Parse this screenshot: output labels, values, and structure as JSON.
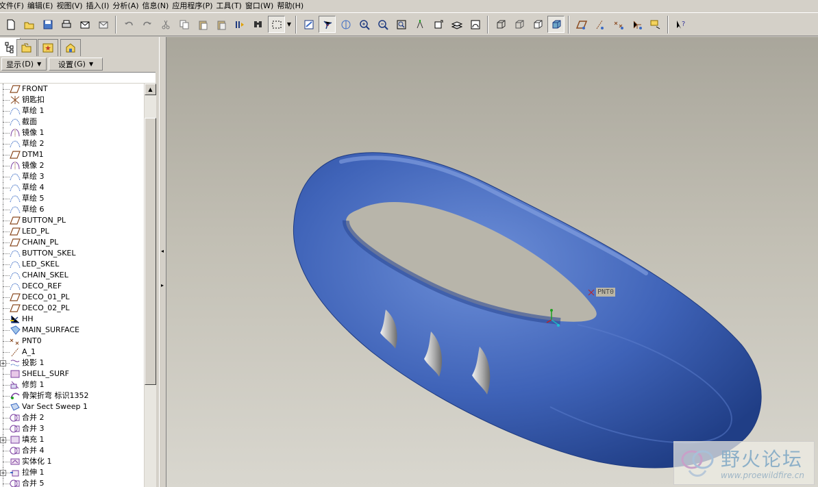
{
  "menu": [
    "文件(F)",
    "编辑(E)",
    "视图(V)",
    "插入(I)",
    "分析(A)",
    "信息(N)",
    "应用程序(P)",
    "工具(T)",
    "窗口(W)",
    "帮助(H)"
  ],
  "toolbar": {
    "groups": [
      [
        "new-file-icon",
        "open-file-icon",
        "save-icon",
        "print-icon",
        "send-mail-icon",
        "email-attach-icon"
      ],
      [
        "undo-icon",
        "redo-icon",
        "cut-icon",
        "copy-icon",
        "paste-icon",
        "paste-special-icon",
        "regenerate-icon",
        "find-icon",
        "select-box-icon"
      ],
      [
        "repaint-icon",
        "spin-center-icon",
        "orient-icon",
        "zoom-in-icon",
        "zoom-out-icon",
        "refit-icon",
        "reorient-icon",
        "saved-views-icon",
        "layers-icon",
        "appearance-icon"
      ],
      [
        "wireframe-icon",
        "hidden-line-icon",
        "no-hidden-icon",
        "shading-icon"
      ],
      [
        "datum-planes-icon",
        "datum-axes-icon",
        "datum-points-icon",
        "csys-icon",
        "annotation-icon"
      ],
      [
        "context-help-icon"
      ]
    ]
  },
  "panel": {
    "show_label": "显示",
    "show_key": "(D)",
    "settings_label": "设置",
    "settings_key": "(G)"
  },
  "tree": [
    {
      "label": "FRONT",
      "icon": "datum-plane-icon",
      "plus": false
    },
    {
      "label": "钥匙扣",
      "icon": "csys-icon",
      "plus": false
    },
    {
      "label": "草绘 1",
      "icon": "sketch-icon",
      "plus": false
    },
    {
      "label": "截面",
      "icon": "sketch-icon",
      "plus": false
    },
    {
      "label": "镜像 1",
      "icon": "mirror-icon",
      "plus": false
    },
    {
      "label": "草绘 2",
      "icon": "sketch-icon",
      "plus": false
    },
    {
      "label": "DTM1",
      "icon": "datum-plane-icon",
      "plus": false
    },
    {
      "label": "镜像 2",
      "icon": "mirror-icon",
      "plus": false
    },
    {
      "label": "草绘 3",
      "icon": "sketch-icon",
      "plus": false
    },
    {
      "label": "草绘 4",
      "icon": "sketch-icon",
      "plus": false
    },
    {
      "label": "草绘 5",
      "icon": "sketch-icon",
      "plus": false
    },
    {
      "label": "草绘 6",
      "icon": "sketch-icon",
      "plus": false
    },
    {
      "label": "BUTTON_PL",
      "icon": "datum-plane-icon",
      "plus": false
    },
    {
      "label": "LED_PL",
      "icon": "datum-plane-icon",
      "plus": false
    },
    {
      "label": "CHAIN_PL",
      "icon": "datum-plane-icon",
      "plus": false
    },
    {
      "label": "BUTTON_SKEL",
      "icon": "sketch-icon",
      "plus": false
    },
    {
      "label": "LED_SKEL",
      "icon": "sketch-icon",
      "plus": false
    },
    {
      "label": "CHAIN_SKEL",
      "icon": "sketch-icon",
      "plus": false
    },
    {
      "label": "DECO_REF",
      "icon": "sketch-icon",
      "plus": false
    },
    {
      "label": "DECO_01_PL",
      "icon": "datum-plane-icon",
      "plus": false
    },
    {
      "label": "DECO_02_PL",
      "icon": "datum-plane-icon",
      "plus": false
    },
    {
      "label": "HH",
      "icon": "coordinate-icon",
      "plus": false
    },
    {
      "label": "MAIN_SURFACE",
      "icon": "surface-icon",
      "plus": false
    },
    {
      "label": "PNT0",
      "icon": "datum-point-icon",
      "plus": false
    },
    {
      "label": "A_1",
      "icon": "datum-axis-icon",
      "plus": false
    },
    {
      "label": "投影 1",
      "icon": "projection-icon",
      "plus": true
    },
    {
      "label": "SHELL_SURF",
      "icon": "shell-surface-icon",
      "plus": false
    },
    {
      "label": "修剪 1",
      "icon": "trim-icon",
      "plus": false
    },
    {
      "label": "骨架折弯 标识1352",
      "icon": "spinal-bend-icon",
      "plus": false
    },
    {
      "label": "Var Sect Sweep 1",
      "icon": "sweep-icon",
      "plus": false
    },
    {
      "label": "合并 2",
      "icon": "merge-icon",
      "plus": false
    },
    {
      "label": "合并 3",
      "icon": "merge-icon",
      "plus": false
    },
    {
      "label": "填充 1",
      "icon": "fill-icon",
      "plus": true
    },
    {
      "label": "合并 4",
      "icon": "merge-icon",
      "plus": false
    },
    {
      "label": "实体化 1",
      "icon": "solidify-icon",
      "plus": false
    },
    {
      "label": "拉伸 1",
      "icon": "extrude-icon",
      "plus": true
    },
    {
      "label": "合并 5",
      "icon": "merge-icon",
      "plus": false
    }
  ],
  "viewport": {
    "point_label": "PNT0",
    "watermark_text": "野火论坛",
    "watermark_url": "www.proewildfire.cn",
    "model_color": "#4a6fc0"
  }
}
